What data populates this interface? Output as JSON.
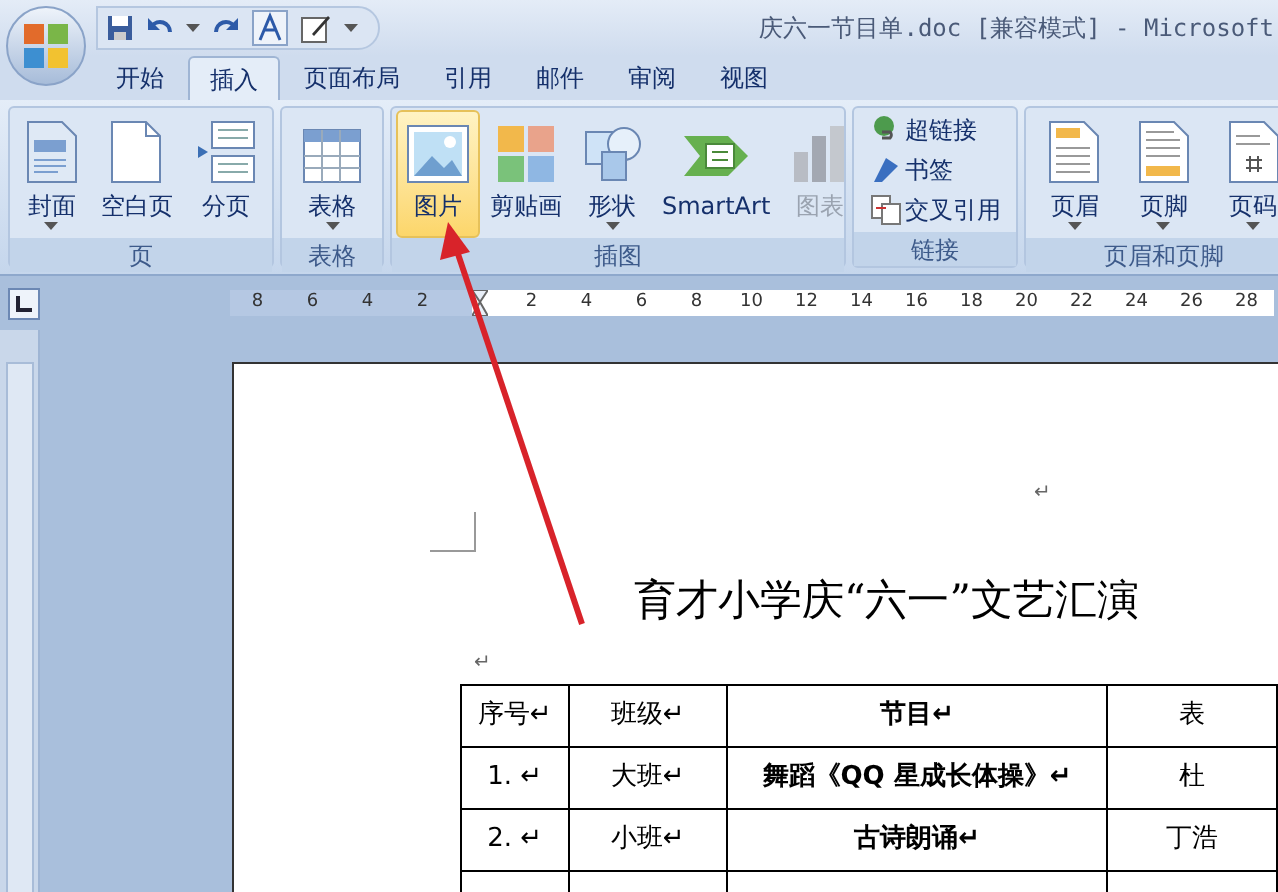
{
  "window": {
    "title": "庆六一节目单.doc [兼容模式] - Microsoft"
  },
  "tabs": [
    {
      "label": "开始",
      "selected": false
    },
    {
      "label": "插入",
      "selected": true
    },
    {
      "label": "页面布局",
      "selected": false
    },
    {
      "label": "引用",
      "selected": false
    },
    {
      "label": "邮件",
      "selected": false
    },
    {
      "label": "审阅",
      "selected": false
    },
    {
      "label": "视图",
      "selected": false
    }
  ],
  "ribbon_groups": [
    {
      "label": "页",
      "kind": "large",
      "buttons": [
        {
          "label": "封面",
          "dropdown": true,
          "highlighted": false,
          "disabled": false
        },
        {
          "label": "空白页",
          "dropdown": false,
          "highlighted": false,
          "disabled": false
        },
        {
          "label": "分页",
          "dropdown": false,
          "highlighted": false,
          "disabled": false
        }
      ]
    },
    {
      "label": "表格",
      "kind": "large",
      "buttons": [
        {
          "label": "表格",
          "dropdown": true,
          "highlighted": false,
          "disabled": false
        }
      ]
    },
    {
      "label": "插图",
      "kind": "large",
      "buttons": [
        {
          "label": "图片",
          "dropdown": false,
          "highlighted": true,
          "disabled": false
        },
        {
          "label": "剪贴画",
          "dropdown": false,
          "highlighted": false,
          "disabled": false
        },
        {
          "label": "形状",
          "dropdown": true,
          "highlighted": false,
          "disabled": false
        },
        {
          "label": "SmartArt",
          "dropdown": false,
          "highlighted": false,
          "disabled": false
        },
        {
          "label": "图表",
          "dropdown": false,
          "highlighted": false,
          "disabled": true
        }
      ]
    },
    {
      "label": "链接",
      "kind": "small",
      "buttons": [
        {
          "label": "超链接",
          "dropdown": false,
          "highlighted": false,
          "disabled": false
        },
        {
          "label": "书签",
          "dropdown": false,
          "highlighted": false,
          "disabled": false
        },
        {
          "label": "交叉引用",
          "dropdown": false,
          "highlighted": false,
          "disabled": false
        }
      ]
    },
    {
      "label": "页眉和页脚",
      "kind": "large",
      "buttons": [
        {
          "label": "页眉",
          "dropdown": true,
          "highlighted": false,
          "disabled": false
        },
        {
          "label": "页脚",
          "dropdown": true,
          "highlighted": false,
          "disabled": false
        },
        {
          "label": "页码",
          "dropdown": true,
          "highlighted": false,
          "disabled": false
        }
      ]
    }
  ],
  "ruler": {
    "left_numbers": [
      "8",
      "6",
      "4",
      "2"
    ],
    "right_numbers": [
      "2",
      "4",
      "6",
      "8",
      "10",
      "12",
      "14",
      "16",
      "18",
      "20",
      "22",
      "24",
      "26",
      "28"
    ]
  },
  "document": {
    "paragraph_mark_top": "↵",
    "title": "育才小学庆“六一”文艺汇演",
    "paragraph_mark": "↵",
    "table": {
      "columns": [
        "序号↵",
        "班级↵",
        "节目↵",
        "表"
      ],
      "rows": [
        [
          "1.  ↵",
          "大班↵",
          "舞蹈《QQ 星成长体操》↵",
          "杜"
        ],
        [
          "2.  ↵",
          "小班↵",
          "古诗朗诵↵",
          "丁浩"
        ]
      ]
    }
  }
}
